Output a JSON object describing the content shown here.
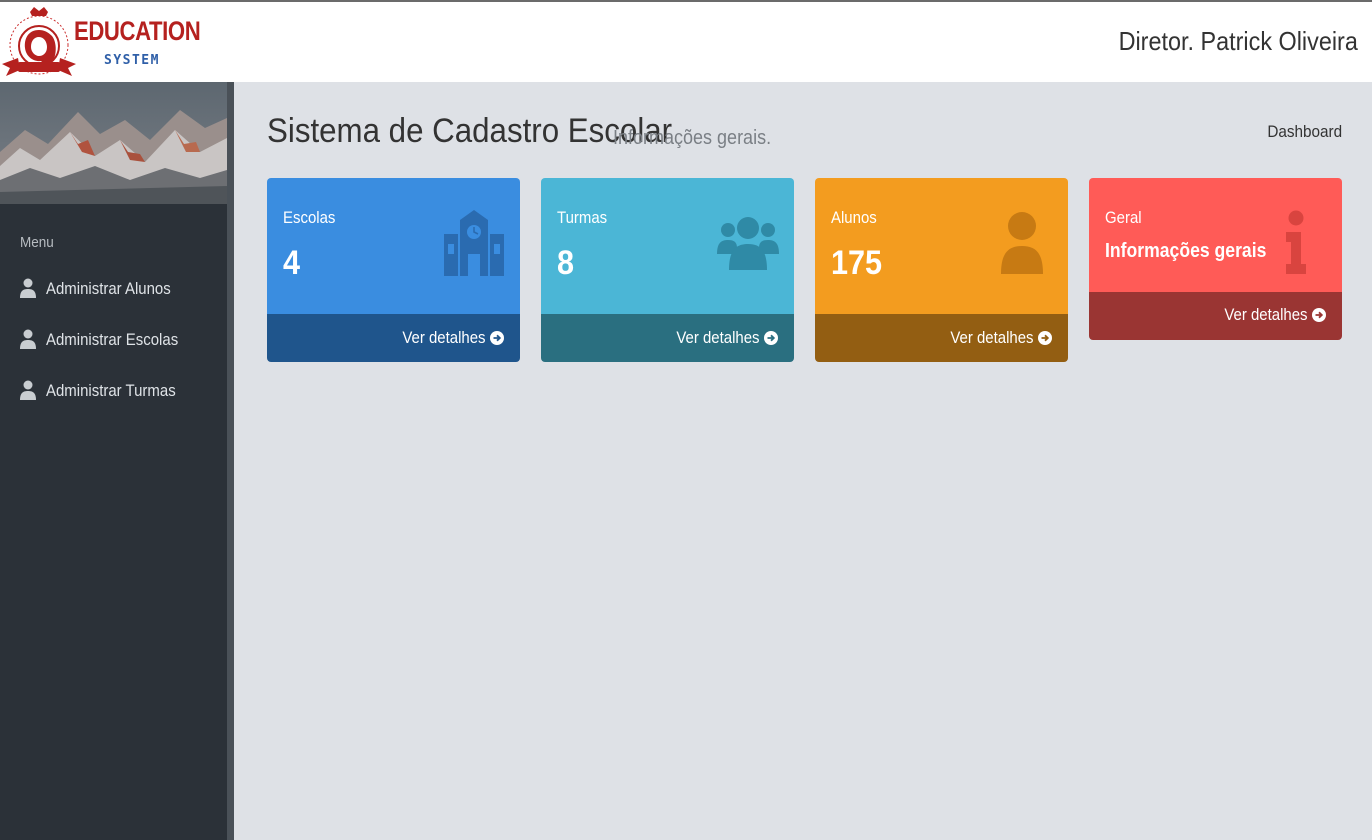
{
  "header": {
    "logo_title": "EDUCATION",
    "logo_subtitle": "SYSTEM",
    "user_name": "Diretor. Patrick Oliveira"
  },
  "sidebar": {
    "menu_heading": "Menu",
    "items": [
      {
        "label": "Administrar Alunos",
        "icon": "user-icon"
      },
      {
        "label": "Administrar Escolas",
        "icon": "user-icon"
      },
      {
        "label": "Administrar Turmas",
        "icon": "user-icon"
      }
    ]
  },
  "main": {
    "title": "Sistema de Cadastro Escolar",
    "subtitle": "Informações gerais.",
    "breadcrumb": "Dashboard",
    "cards": [
      {
        "label": "Escolas",
        "value": "4",
        "footer": "Ver detalhes",
        "icon": "school-icon",
        "color": "#3a8de0"
      },
      {
        "label": "Turmas",
        "value": "8",
        "footer": "Ver detalhes",
        "icon": "users-icon",
        "color": "#4bb6d6"
      },
      {
        "label": "Alunos",
        "value": "175",
        "footer": "Ver detalhes",
        "icon": "user-icon",
        "color": "#f39c1f"
      },
      {
        "label": "Geral",
        "value": "Informações gerais",
        "footer": "Ver detalhes",
        "icon": "info-icon",
        "color": "#ff5b57"
      }
    ]
  },
  "colors": {
    "sidebar_bg": "#2b3138",
    "content_bg": "#dee1e6",
    "brand_red": "#b5211f",
    "brand_blue": "#2f5fa8"
  }
}
